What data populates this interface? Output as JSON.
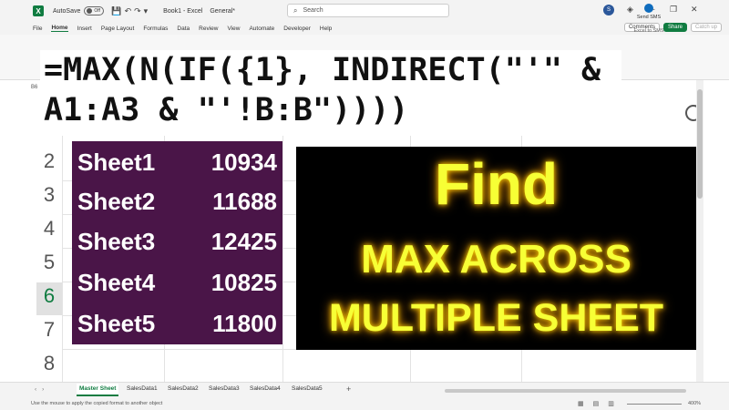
{
  "titlebar": {
    "autosave_label": "AutoSave",
    "autosave_state": "Off",
    "doc_title": "Book1 - Excel",
    "sensitivity": "General*",
    "search_placeholder": "Search",
    "user_initial": "S"
  },
  "menu": {
    "tabs": [
      "File",
      "Home",
      "Insert",
      "Page Layout",
      "Formulas",
      "Data",
      "Review",
      "View",
      "Automate",
      "Developer",
      "Help"
    ],
    "comments": "Comments",
    "share": "Share",
    "catchup": "Catch up"
  },
  "ribbon": {
    "sms_label": "Send SMS",
    "sms_group": "Excel to SMS"
  },
  "formula_bar": {
    "name_box": "B6"
  },
  "overlay_formula": {
    "line1": "=MAX(N(IF({1}, INDIRECT(\"'\" &",
    "line2": "A1:A3 & \"'!B:B\"))))"
  },
  "row_numbers": [
    "2",
    "3",
    "4",
    "5",
    "6",
    "7",
    "8"
  ],
  "selected_row": "6",
  "sheet_values": [
    {
      "name": "Sheet1",
      "value": "10934"
    },
    {
      "name": "Sheet2",
      "value": "11688"
    },
    {
      "name": "Sheet3",
      "value": "12425"
    },
    {
      "name": "Sheet4",
      "value": "10825"
    },
    {
      "name": "Sheet5",
      "value": "11800"
    }
  ],
  "banner": {
    "line1": "Find",
    "line2": "MAX ACROSS",
    "line3": "MULTIPLE SHEET"
  },
  "sheet_tabs": [
    "Master Sheet",
    "SalesData1",
    "SalesData2",
    "SalesData3",
    "SalesData4",
    "SalesData5"
  ],
  "active_sheet": "Master Sheet",
  "status": {
    "message": "Use the mouse to apply the copied format to another object",
    "zoom": "400%"
  },
  "colors": {
    "excel_green": "#107c41",
    "table_bg": "#4a1548",
    "banner_text": "#f7ff35"
  }
}
